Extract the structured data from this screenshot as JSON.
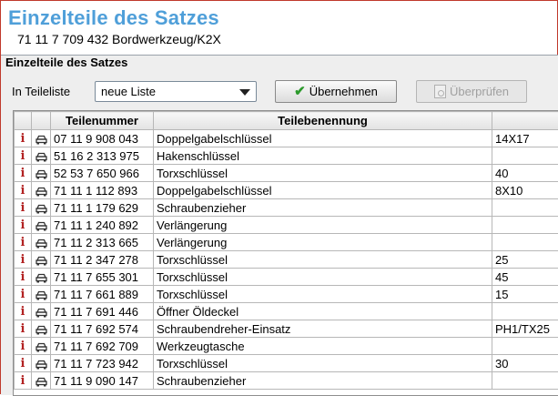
{
  "header": {
    "title": "Einzelteile des Satzes",
    "subtitle": "71 11 7 709 432 Bordwerkzeug/K2X"
  },
  "panel": {
    "title": "Einzelteile des Satzes",
    "list_label": "In Teileliste",
    "list_select_value": "neue Liste",
    "apply_button": "Übernehmen",
    "check_button": "Überprüfen"
  },
  "table": {
    "columns": [
      "",
      "",
      "Teilenummer",
      "Teilebenennung",
      ""
    ],
    "rows": [
      {
        "nr": "07 11 9 908 043",
        "name": "Doppelgabelschlüssel",
        "extra": "14X17"
      },
      {
        "nr": "51 16 2 313 975",
        "name": "Hakenschlüssel",
        "extra": ""
      },
      {
        "nr": "52 53 7 650 966",
        "name": "Torxschlüssel",
        "extra": "40"
      },
      {
        "nr": "71 11 1 112 893",
        "name": "Doppelgabelschlüssel",
        "extra": "8X10"
      },
      {
        "nr": "71 11 1 179 629",
        "name": "Schraubenzieher",
        "extra": ""
      },
      {
        "nr": "71 11 1 240 892",
        "name": "Verlängerung",
        "extra": ""
      },
      {
        "nr": "71 11 2 313 665",
        "name": "Verlängerung",
        "extra": ""
      },
      {
        "nr": "71 11 2 347 278",
        "name": "Torxschlüssel",
        "extra": "25"
      },
      {
        "nr": "71 11 7 655 301",
        "name": "Torxschlüssel",
        "extra": "45"
      },
      {
        "nr": "71 11 7 661 889",
        "name": "Torxschlüssel",
        "extra": "15"
      },
      {
        "nr": "71 11 7 691 446",
        "name": "Öffner Öldeckel",
        "extra": ""
      },
      {
        "nr": "71 11 7 692 574",
        "name": "Schraubendreher-Einsatz",
        "extra": "PH1/TX25"
      },
      {
        "nr": "71 11 7 692 709",
        "name": "Werkzeugtasche",
        "extra": ""
      },
      {
        "nr": "71 11 7 723 942",
        "name": "Torxschlüssel",
        "extra": "30"
      },
      {
        "nr": "71 11 9 090 147",
        "name": "Schraubenzieher",
        "extra": ""
      }
    ],
    "info_icon": "info-icon",
    "vehicle_icon": "car-icon"
  },
  "colors": {
    "title": "#4f9fd9",
    "info_icon": "#b22222",
    "check_icon": "#2c9a2c",
    "panel_bg": "#eeeeee"
  }
}
